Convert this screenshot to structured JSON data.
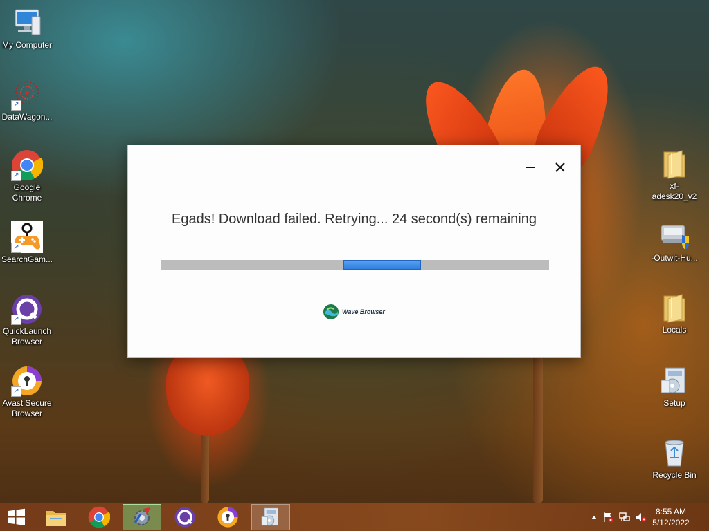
{
  "desktop": {
    "left_icons": [
      {
        "label": "My Computer",
        "icon": "computer-icon",
        "shortcut": false
      },
      {
        "label": "DataWagon...",
        "icon": "datawagon-icon",
        "shortcut": true
      },
      {
        "label": "Google Chrome",
        "icon": "chrome-icon",
        "shortcut": true
      },
      {
        "label": "SearchGam...",
        "icon": "gamepad-icon",
        "shortcut": true
      },
      {
        "label": "QuickLaunch Browser",
        "icon": "quicklaunch-icon",
        "shortcut": true
      },
      {
        "label": "Avast Secure Browser",
        "icon": "avast-icon",
        "shortcut": true
      }
    ],
    "right_icons": [
      {
        "label": "xf-adesk20_v2",
        "icon": "folder-icon"
      },
      {
        "label": "-Outwit-Hu...",
        "icon": "installer-icon"
      },
      {
        "label": "Locals",
        "icon": "folder-icon"
      },
      {
        "label": "Setup",
        "icon": "setup-icon"
      },
      {
        "label": "Recycle Bin",
        "icon": "recycle-bin-icon"
      }
    ]
  },
  "dialog": {
    "message": "Egads! Download failed. Retrying... 24 second(s) remaining",
    "progress_indeterminate_segment": {
      "start": 0.47,
      "end": 0.67
    },
    "brand_name": "Wave Browser",
    "minimize_icon": "minimize-icon",
    "close_icon": "close-icon"
  },
  "taskbar": {
    "start_icon": "windows-start-icon",
    "items": [
      {
        "icon": "file-explorer-icon",
        "state": "normal"
      },
      {
        "icon": "chrome-icon",
        "state": "normal"
      },
      {
        "icon": "installer-gear-icon",
        "state": "active"
      },
      {
        "icon": "quicklaunch-icon",
        "state": "normal"
      },
      {
        "icon": "avast-icon",
        "state": "normal"
      },
      {
        "icon": "setup-icon",
        "state": "pinned-open"
      }
    ],
    "tray_icons": [
      "show-hidden-icon",
      "action-center-flag-icon",
      "network-icon",
      "volume-muted-icon"
    ],
    "time": "8:55 AM",
    "date": "5/12/2022"
  },
  "colors": {
    "progress_fill": "#2f7fe0",
    "progress_track": "#bcbcbc",
    "active_taskbar": "#78c878"
  }
}
